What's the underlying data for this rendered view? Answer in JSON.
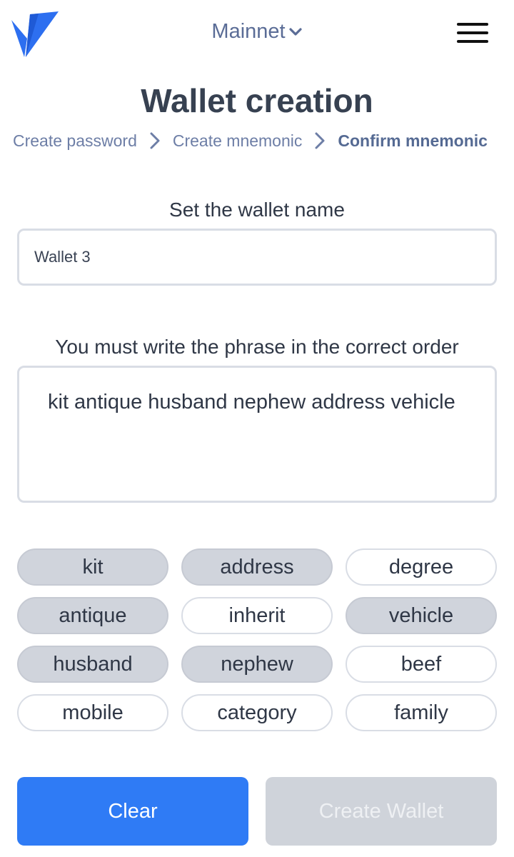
{
  "header": {
    "logo_icon": "vite-logo-icon",
    "network": "Mainnet",
    "network_icon": "chevron-down-icon",
    "menu_icon": "hamburger-menu-icon"
  },
  "title": "Wallet creation",
  "breadcrumb": {
    "steps": [
      "Create password",
      "Create mnemonic",
      "Confirm mnemonic"
    ],
    "separator_icon": "chevron-right-icon",
    "active_index": 2
  },
  "wallet_name": {
    "label": "Set the wallet name",
    "value": "Wallet 3"
  },
  "phrase": {
    "label": "You must write the phrase in the correct order",
    "value": "kit antique husband nephew address vehicle"
  },
  "words": [
    {
      "text": "kit",
      "selected": true
    },
    {
      "text": "address",
      "selected": true
    },
    {
      "text": "degree",
      "selected": false
    },
    {
      "text": "antique",
      "selected": true
    },
    {
      "text": "inherit",
      "selected": false
    },
    {
      "text": "vehicle",
      "selected": true
    },
    {
      "text": "husband",
      "selected": true
    },
    {
      "text": "nephew",
      "selected": true
    },
    {
      "text": "beef",
      "selected": false
    },
    {
      "text": "mobile",
      "selected": false
    },
    {
      "text": "category",
      "selected": false
    },
    {
      "text": "family",
      "selected": false
    }
  ],
  "buttons": {
    "clear": "Clear",
    "create": "Create Wallet"
  },
  "colors": {
    "accent": "#2f7bf5",
    "logo": "#2d6ff0",
    "selected_chip": "#d0d4dc",
    "disabled_button": "#cfd3da"
  }
}
